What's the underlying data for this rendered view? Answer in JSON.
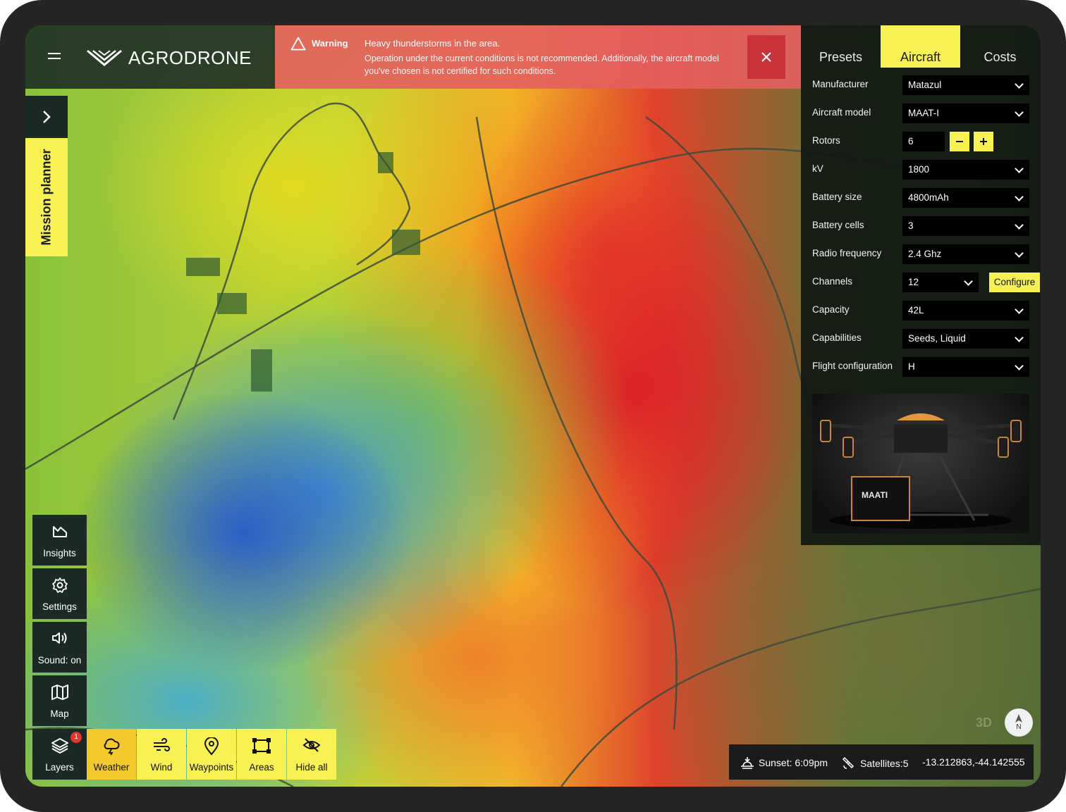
{
  "app": {
    "brand": "AGRODRONE"
  },
  "warning": {
    "title": "Warning",
    "heading": "Heavy thunderstorms in the area.",
    "message": "Operation under the current conditions is not recommended. Additionally, the aircraft model you've chosen is not certified for such conditions."
  },
  "mission_planner": {
    "label": "Mission planner"
  },
  "panel": {
    "tabs": [
      "Presets",
      "Aircraft",
      "Costs"
    ],
    "active_tab": "Aircraft",
    "fields": {
      "manufacturer": {
        "label": "Manufacturer",
        "value": "Matazul"
      },
      "aircraft_model": {
        "label": "Aircraft model",
        "value": "MAAT-I"
      },
      "rotors": {
        "label": "Rotors",
        "value": "6"
      },
      "kv": {
        "label": "kV",
        "value": "1800"
      },
      "battery_size": {
        "label": "Battery size",
        "value": "4800mAh"
      },
      "battery_cells": {
        "label": "Battery cells",
        "value": "3"
      },
      "radio_frequency": {
        "label": "Radio frequency",
        "value": "2.4 Ghz"
      },
      "channels": {
        "label": "Channels",
        "value": "12",
        "action": "Configure"
      },
      "capacity": {
        "label": "Capacity",
        "value": "42L"
      },
      "capabilities": {
        "label": "Capabilities",
        "value": "Seeds, Liquid"
      },
      "flight_configuration": {
        "label": "Flight configuration",
        "value": "H"
      }
    },
    "drone_brand_text": "MAATI"
  },
  "tools": {
    "insights": "Insights",
    "settings": "Settings",
    "sound": "Sound: on",
    "map": "Map",
    "layers": "Layers",
    "layers_badge": "1",
    "weather": "Weather",
    "wind": "Wind",
    "waypoints": "Waypoints",
    "areas": "Areas",
    "hide_all": "Hide all"
  },
  "status": {
    "sunset": "Sunset: 6:09pm",
    "satellites": "Satellites:5",
    "coordinates": "-13.212863,-44.142555"
  },
  "map": {
    "mode_3d": "3D",
    "compass": "N"
  },
  "colors": {
    "accent": "#f7f153",
    "dark": "#1b2a24",
    "warning": "#e45f5f",
    "close": "#c93339"
  }
}
